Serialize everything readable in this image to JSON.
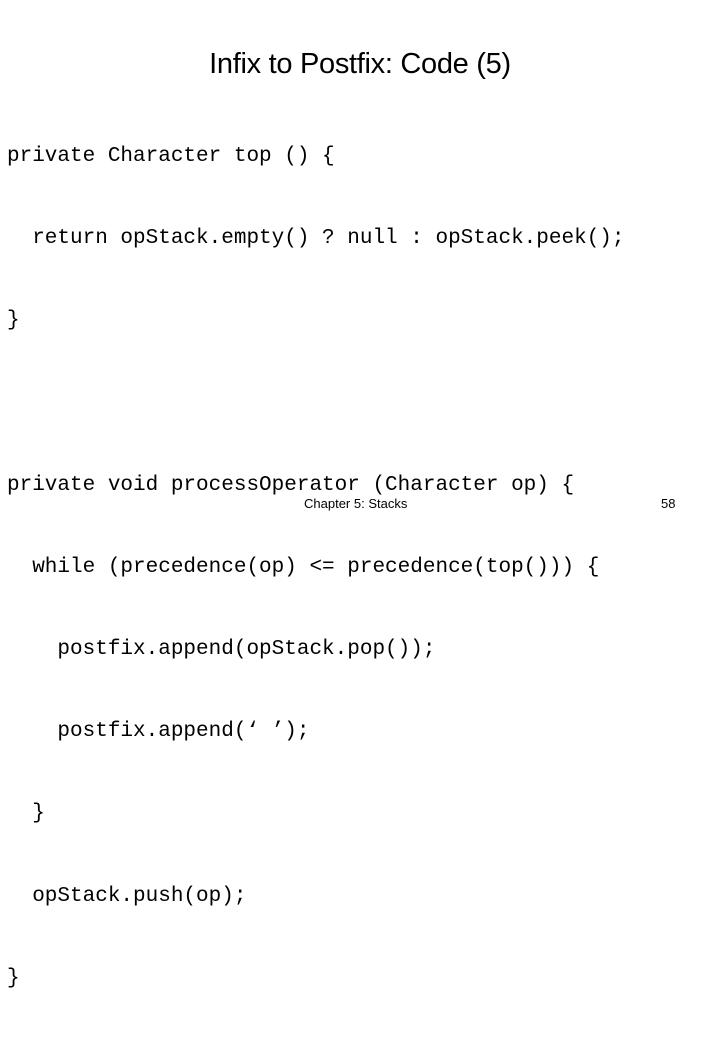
{
  "slide": {
    "title": "Infix to Postfix: Code (5)",
    "code_lines": [
      "private Character top () {",
      "  return opStack.empty() ? null : opStack.peek();",
      "}",
      "",
      "private void processOperator (Character op) {",
      "  while (precedence(op) <= precedence(top())) {",
      "    postfix.append(opStack.pop());",
      "    postfix.append(‘ ’);",
      "  }",
      "  opStack.push(op);",
      "}"
    ],
    "footer": {
      "chapter": "Chapter 5: Stacks",
      "page_number": "58"
    }
  }
}
